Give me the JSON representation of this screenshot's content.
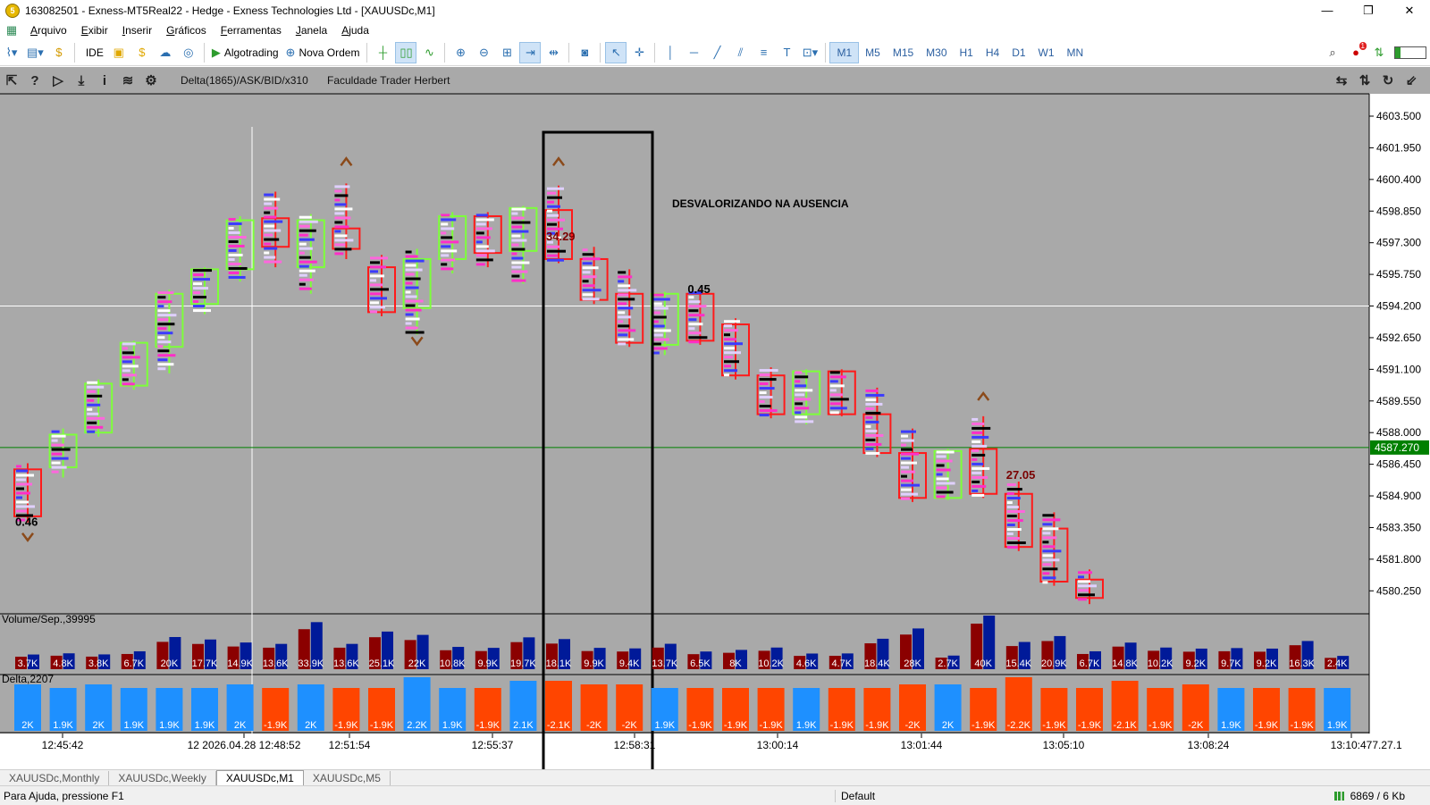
{
  "window": {
    "title": "163082501 - Exness-MT5Real22 - Hedge - Exness Technologies Ltd - [XAUUSDc,M1]",
    "minimize": "—",
    "restore": "❐",
    "close": "✕",
    "app_icon": "5"
  },
  "menu": [
    "Arquivo",
    "Exibir",
    "Inserir",
    "Gráficos",
    "Ferramentas",
    "Janela",
    "Ajuda"
  ],
  "toolbar": {
    "ide_label": "IDE",
    "algotrading_label": "Algotrading",
    "nova_ordem_label": "Nova Ordem",
    "timeframes": [
      "M1",
      "M5",
      "M15",
      "M30",
      "H1",
      "H4",
      "D1",
      "W1",
      "MN"
    ],
    "active_timeframe": "M1",
    "notification_count": "1"
  },
  "chart": {
    "indicator_caption": "Delta(1865)/ASK/BID/x310",
    "caption2": "Faculdade Trader Herbert",
    "annotation": "DESVALORIZANDO NA AUSENCIA",
    "volume_panel_label": "Volume/Sep.,39995",
    "delta_panel_label": "Delta,2207",
    "current_price": "4587.270",
    "price_labels": [
      "4603.500",
      "4601.950",
      "4600.400",
      "4598.850",
      "4597.300",
      "4595.750",
      "4594.200",
      "4592.650",
      "4591.100",
      "4589.550",
      "4588.000",
      "4586.450",
      "4584.900",
      "4583.350",
      "4581.800",
      "4580.250"
    ],
    "time_labels": [
      "12:45:42",
      "12 2026.04.28 12:48:52",
      "12:51:54",
      "12:55:37",
      "12:58:31",
      "13:00:14",
      "13:01:44",
      "13:05:10",
      "13:08:24",
      "13:10:47"
    ],
    "version_label": "7.27.1",
    "value_labels": [
      {
        "text": "0.46",
        "price": 4583.6,
        "bar": 0
      },
      {
        "text": "34.29",
        "price": 4597.6,
        "bar": 15
      },
      {
        "text": "0.45",
        "price": 4595.0,
        "bar": 19
      },
      {
        "text": "27.05",
        "price": 4585.9,
        "bar": 28
      }
    ],
    "colors": {
      "background": "#a9a9a9",
      "bull_box": "#7dff3a",
      "bear_box": "#ff1a1a",
      "volume_bull": "#001a99",
      "volume_bear": "#8b0000",
      "delta_pos": "#1e90ff",
      "delta_neg": "#ff4500",
      "current_price_line": "#008000"
    }
  },
  "chart_data": {
    "type": "candlestick",
    "price_range": [
      4579.5,
      4604.0
    ],
    "candles": [
      {
        "o": 4586.2,
        "c": 4583.9,
        "h": 4586.5,
        "l": 4583.6,
        "vol": "3.7K",
        "delta": "2K",
        "bull": false
      },
      {
        "o": 4586.3,
        "c": 4587.9,
        "h": 4588.2,
        "l": 4585.8,
        "vol": "4.8K",
        "delta": "1.9K",
        "bull": true
      },
      {
        "o": 4588.0,
        "c": 4590.4,
        "h": 4590.6,
        "l": 4587.8,
        "vol": "3.8K",
        "delta": "2K",
        "bull": true
      },
      {
        "o": 4590.3,
        "c": 4592.4,
        "h": 4592.5,
        "l": 4590.1,
        "vol": "6.7K",
        "delta": "1.9K",
        "bull": true
      },
      {
        "o": 4592.2,
        "c": 4594.8,
        "h": 4595.0,
        "l": 4590.9,
        "vol": "20K",
        "delta": "1.9K",
        "bull": true
      },
      {
        "o": 4594.3,
        "c": 4596.0,
        "h": 4596.1,
        "l": 4593.8,
        "vol": "17.7K",
        "delta": "1.9K",
        "bull": true
      },
      {
        "o": 4596.0,
        "c": 4598.4,
        "h": 4598.6,
        "l": 4595.4,
        "vol": "14.9K",
        "delta": "2K",
        "bull": true
      },
      {
        "o": 4598.5,
        "c": 4597.1,
        "h": 4599.8,
        "l": 4596.1,
        "vol": "13.6K",
        "delta": "-1.9K",
        "bull": false
      },
      {
        "o": 4596.1,
        "c": 4598.4,
        "h": 4598.7,
        "l": 4594.8,
        "vol": "33.9K",
        "delta": "2K",
        "bull": true
      },
      {
        "o": 4598.0,
        "c": 4597.0,
        "h": 4600.2,
        "l": 4596.5,
        "vol": "13.6K",
        "delta": "-1.9K",
        "bull": false
      },
      {
        "o": 4596.1,
        "c": 4593.9,
        "h": 4596.7,
        "l": 4593.7,
        "vol": "25.1K",
        "delta": "-1.9K",
        "bull": false
      },
      {
        "o": 4594.1,
        "c": 4596.5,
        "h": 4597.0,
        "l": 4592.8,
        "vol": "22K",
        "delta": "2.2K",
        "bull": true
      },
      {
        "o": 4596.5,
        "c": 4598.6,
        "h": 4598.8,
        "l": 4595.8,
        "vol": "10.8K",
        "delta": "1.9K",
        "bull": true
      },
      {
        "o": 4598.6,
        "c": 4596.8,
        "h": 4598.8,
        "l": 4596.1,
        "vol": "9.9K",
        "delta": "-1.9K",
        "bull": false
      },
      {
        "o": 4596.9,
        "c": 4599.0,
        "h": 4599.1,
        "l": 4595.3,
        "vol": "19.7K",
        "delta": "2.1K",
        "bull": true
      },
      {
        "o": 4598.9,
        "c": 4596.5,
        "h": 4600.1,
        "l": 4596.3,
        "vol": "18.1K",
        "delta": "-2.1K",
        "bull": false
      },
      {
        "o": 4596.5,
        "c": 4594.5,
        "h": 4597.1,
        "l": 4594.3,
        "vol": "9.9K",
        "delta": "-2K",
        "bull": false
      },
      {
        "o": 4594.8,
        "c": 4592.4,
        "h": 4596.0,
        "l": 4592.2,
        "vol": "9.4K",
        "delta": "-2K",
        "bull": false
      },
      {
        "o": 4592.3,
        "c": 4594.8,
        "h": 4594.9,
        "l": 4591.8,
        "vol": "13.7K",
        "delta": "1.9K",
        "bull": true
      },
      {
        "o": 4594.8,
        "c": 4592.5,
        "h": 4595.0,
        "l": 4592.3,
        "vol": "6.5K",
        "delta": "-1.9K",
        "bull": false
      },
      {
        "o": 4593.3,
        "c": 4590.8,
        "h": 4593.6,
        "l": 4590.6,
        "vol": "8K",
        "delta": "-1.9K",
        "bull": false
      },
      {
        "o": 4590.8,
        "c": 4588.9,
        "h": 4591.2,
        "l": 4588.7,
        "vol": "10.2K",
        "delta": "-1.9K",
        "bull": false
      },
      {
        "o": 4588.9,
        "c": 4591.0,
        "h": 4591.1,
        "l": 4588.4,
        "vol": "4.6K",
        "delta": "1.9K",
        "bull": true
      },
      {
        "o": 4591.0,
        "c": 4588.9,
        "h": 4591.1,
        "l": 4588.8,
        "vol": "4.7K",
        "delta": "-1.9K",
        "bull": false
      },
      {
        "o": 4588.9,
        "c": 4587.0,
        "h": 4590.2,
        "l": 4586.8,
        "vol": "18.4K",
        "delta": "-1.9K",
        "bull": false
      },
      {
        "o": 4587.0,
        "c": 4584.8,
        "h": 4588.2,
        "l": 4584.6,
        "vol": "28K",
        "delta": "-2K",
        "bull": false
      },
      {
        "o": 4584.8,
        "c": 4587.1,
        "h": 4587.2,
        "l": 4584.7,
        "vol": "2.7K",
        "delta": "2K",
        "bull": true
      },
      {
        "o": 4587.2,
        "c": 4585.0,
        "h": 4588.8,
        "l": 4584.8,
        "vol": "40K",
        "delta": "-1.9K",
        "bull": false
      },
      {
        "o": 4585.0,
        "c": 4582.4,
        "h": 4585.6,
        "l": 4582.2,
        "vol": "15.4K",
        "delta": "-2.2K",
        "bull": false
      },
      {
        "o": 4583.3,
        "c": 4580.7,
        "h": 4584.1,
        "l": 4580.5,
        "vol": "20.9K",
        "delta": "-1.9K",
        "bull": false
      },
      {
        "o": 4580.8,
        "c": 4579.9,
        "h": 4581.3,
        "l": 4579.6,
        "vol": "6.7K",
        "delta": "-1.9K",
        "bull": false
      },
      {
        "o": null,
        "c": null,
        "h": null,
        "l": null,
        "vol": "14.8K",
        "delta": "-2.1K",
        "bull": false
      },
      {
        "o": null,
        "c": null,
        "h": null,
        "l": null,
        "vol": "10.2K",
        "delta": "-1.9K",
        "bull": false
      },
      {
        "o": null,
        "c": null,
        "h": null,
        "l": null,
        "vol": "9.2K",
        "delta": "-2K",
        "bull": false
      },
      {
        "o": null,
        "c": null,
        "h": null,
        "l": null,
        "vol": "9.7K",
        "delta": "1.9K",
        "bull": true
      },
      {
        "o": null,
        "c": null,
        "h": null,
        "l": null,
        "vol": "9.2K",
        "delta": "-1.9K",
        "bull": false
      },
      {
        "o": null,
        "c": null,
        "h": null,
        "l": null,
        "vol": "16.3K",
        "delta": "-1.9K",
        "bull": false
      },
      {
        "o": null,
        "c": null,
        "h": null,
        "l": null,
        "vol": "2.4K",
        "delta": "1.9K",
        "bull": true
      }
    ],
    "current_price": 4587.27,
    "crosshair_price": 4594.2
  },
  "tabs": [
    "XAUUSDc,Monthly",
    "XAUUSDc,Weekly",
    "XAUUSDc,M1",
    "XAUUSDc,M5"
  ],
  "active_tab": "XAUUSDc,M1",
  "status": {
    "help": "Para Ajuda, pressione F1",
    "profile": "Default",
    "connection": "6869 / 6 Kb"
  }
}
